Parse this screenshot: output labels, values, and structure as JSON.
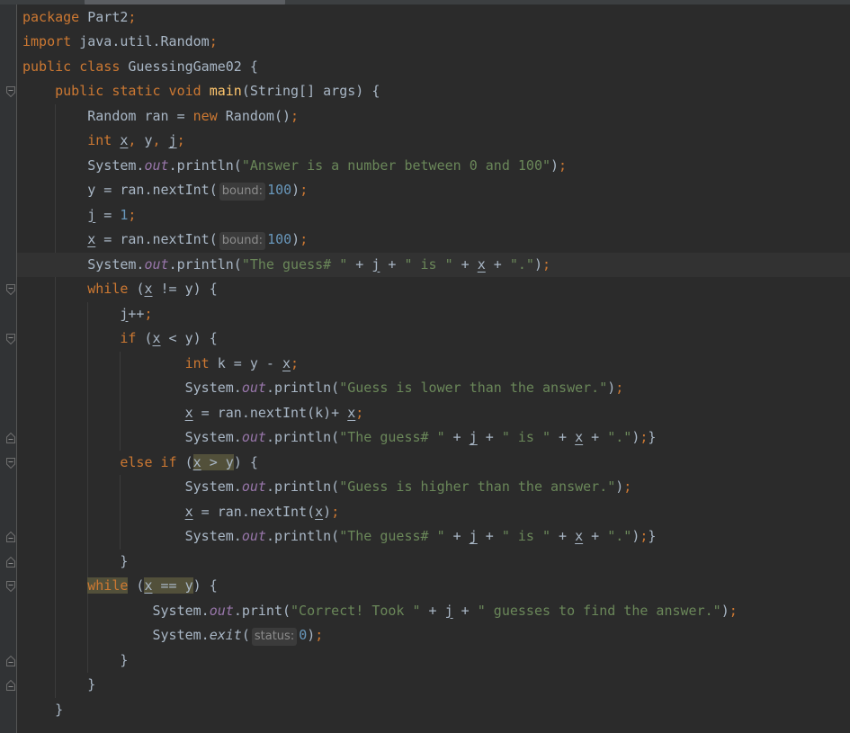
{
  "editor": {
    "language": "java",
    "current_line": 11,
    "lines": [
      {
        "n": 1,
        "tokens": [
          [
            "kw",
            "package "
          ],
          [
            "p",
            "Part2"
          ],
          [
            "semi",
            ";"
          ]
        ]
      },
      {
        "n": 2,
        "tokens": [
          [
            "kw",
            "import "
          ],
          [
            "p",
            "java.util.Random"
          ],
          [
            "semi",
            ";"
          ]
        ]
      },
      {
        "n": 3,
        "tokens": [
          [
            "kw",
            "public class "
          ],
          [
            "p",
            "GuessingGame02 {"
          ]
        ]
      },
      {
        "n": 4,
        "tokens": [
          [
            "kw",
            "    public static void "
          ],
          [
            "mth",
            "main"
          ],
          [
            "p",
            "(String[] args) {"
          ]
        ]
      },
      {
        "n": 5,
        "tokens": [
          [
            "p",
            "        Random ran = "
          ],
          [
            "kw",
            "new "
          ],
          [
            "p",
            "Random()"
          ],
          [
            "semi",
            ";"
          ]
        ]
      },
      {
        "n": 6,
        "tokens": [
          [
            "kw",
            "        int "
          ],
          [
            "var",
            "x"
          ],
          [
            "semi",
            ", "
          ],
          [
            "p",
            "y"
          ],
          [
            "semi",
            ", "
          ],
          [
            "var",
            "j"
          ],
          [
            "semi",
            ";"
          ]
        ]
      },
      {
        "n": 7,
        "tokens": [
          [
            "p",
            "        System."
          ],
          [
            "fld",
            "out"
          ],
          [
            "p",
            ".println("
          ],
          [
            "str",
            "\"Answer is a number between 0 and 100\""
          ],
          [
            "p",
            ")"
          ],
          [
            "semi",
            ";"
          ]
        ]
      },
      {
        "n": 8,
        "tokens": [
          [
            "p",
            "        y = ran.nextInt("
          ],
          [
            "hint",
            "bound:"
          ],
          [
            "num",
            "100"
          ],
          [
            "p",
            ")"
          ],
          [
            "semi",
            ";"
          ]
        ]
      },
      {
        "n": 9,
        "tokens": [
          [
            "p",
            "        "
          ],
          [
            "var",
            "j"
          ],
          [
            "p",
            " = "
          ],
          [
            "num",
            "1"
          ],
          [
            "semi",
            ";"
          ]
        ]
      },
      {
        "n": 10,
        "tokens": [
          [
            "p",
            "        "
          ],
          [
            "var",
            "x"
          ],
          [
            "p",
            " = ran.nextInt("
          ],
          [
            "hint",
            "bound:"
          ],
          [
            "num",
            "100"
          ],
          [
            "p",
            ")"
          ],
          [
            "semi",
            ";"
          ]
        ]
      },
      {
        "n": 11,
        "tokens": [
          [
            "p",
            "        System."
          ],
          [
            "fld",
            "out"
          ],
          [
            "p",
            ".println("
          ],
          [
            "str",
            "\"The guess# \""
          ],
          [
            "p",
            " + "
          ],
          [
            "var",
            "j"
          ],
          [
            "p",
            " + "
          ],
          [
            "str",
            "\" is \""
          ],
          [
            "p",
            " + "
          ],
          [
            "var",
            "x"
          ],
          [
            "p",
            " + "
          ],
          [
            "str",
            "\".\""
          ],
          [
            "p",
            ")"
          ],
          [
            "semi",
            ";"
          ]
        ]
      },
      {
        "n": 12,
        "tokens": [
          [
            "kw",
            "        while "
          ],
          [
            "p",
            "("
          ],
          [
            "var",
            "x"
          ],
          [
            "p",
            " != y) {"
          ]
        ]
      },
      {
        "n": 13,
        "tokens": [
          [
            "p",
            "            "
          ],
          [
            "var",
            "j"
          ],
          [
            "p",
            "++"
          ],
          [
            "semi",
            ";"
          ]
        ]
      },
      {
        "n": 14,
        "tokens": [
          [
            "kw",
            "            if "
          ],
          [
            "p",
            "("
          ],
          [
            "var",
            "x"
          ],
          [
            "p",
            " < y) {"
          ]
        ]
      },
      {
        "n": 15,
        "tokens": [
          [
            "kw",
            "                    int "
          ],
          [
            "p",
            "k = y - "
          ],
          [
            "var",
            "x"
          ],
          [
            "semi",
            ";"
          ]
        ]
      },
      {
        "n": 16,
        "tokens": [
          [
            "p",
            "                    System."
          ],
          [
            "fld",
            "out"
          ],
          [
            "p",
            ".println("
          ],
          [
            "str",
            "\"Guess is lower than the answer.\""
          ],
          [
            "p",
            ")"
          ],
          [
            "semi",
            ";"
          ]
        ]
      },
      {
        "n": 17,
        "tokens": [
          [
            "p",
            "                    "
          ],
          [
            "var",
            "x"
          ],
          [
            "p",
            " = ran.nextInt(k)+ "
          ],
          [
            "var",
            "x"
          ],
          [
            "semi",
            ";"
          ]
        ]
      },
      {
        "n": 18,
        "tokens": [
          [
            "p",
            "                    System."
          ],
          [
            "fld",
            "out"
          ],
          [
            "p",
            ".println("
          ],
          [
            "str",
            "\"The guess# \""
          ],
          [
            "p",
            " + "
          ],
          [
            "var",
            "j"
          ],
          [
            "p",
            " + "
          ],
          [
            "str",
            "\" is \""
          ],
          [
            "p",
            " + "
          ],
          [
            "var",
            "x"
          ],
          [
            "p",
            " + "
          ],
          [
            "str",
            "\".\""
          ],
          [
            "p",
            ")"
          ],
          [
            "semi",
            ";"
          ],
          [
            "p",
            "}"
          ]
        ]
      },
      {
        "n": 19,
        "tokens": [
          [
            "kw",
            "            else if "
          ],
          [
            "p",
            "("
          ],
          [
            "hlvar",
            "x"
          ],
          [
            "hl",
            " > y"
          ],
          [
            "p",
            ") {"
          ]
        ]
      },
      {
        "n": 20,
        "tokens": [
          [
            "p",
            "                    System."
          ],
          [
            "fld",
            "out"
          ],
          [
            "p",
            ".println("
          ],
          [
            "str",
            "\"Guess is higher than the answer.\""
          ],
          [
            "p",
            ")"
          ],
          [
            "semi",
            ";"
          ]
        ]
      },
      {
        "n": 21,
        "tokens": [
          [
            "p",
            "                    "
          ],
          [
            "var",
            "x"
          ],
          [
            "p",
            " = ran.nextInt("
          ],
          [
            "var",
            "x"
          ],
          [
            "p",
            ")"
          ],
          [
            "semi",
            ";"
          ]
        ]
      },
      {
        "n": 22,
        "tokens": [
          [
            "p",
            "                    System."
          ],
          [
            "fld",
            "out"
          ],
          [
            "p",
            ".println("
          ],
          [
            "str",
            "\"The guess# \""
          ],
          [
            "p",
            " + "
          ],
          [
            "var",
            "j"
          ],
          [
            "p",
            " + "
          ],
          [
            "str",
            "\" is \""
          ],
          [
            "p",
            " + "
          ],
          [
            "var",
            "x"
          ],
          [
            "p",
            " + "
          ],
          [
            "str",
            "\".\""
          ],
          [
            "p",
            ")"
          ],
          [
            "semi",
            ";"
          ],
          [
            "p",
            "}"
          ]
        ]
      },
      {
        "n": 23,
        "tokens": [
          [
            "p",
            "            }"
          ]
        ]
      },
      {
        "n": 24,
        "tokens": [
          [
            "p",
            "        "
          ],
          [
            "hlkw",
            "while"
          ],
          [
            "p",
            " ("
          ],
          [
            "hlvar",
            "x"
          ],
          [
            "hl",
            " == y"
          ],
          [
            "p",
            ") {"
          ]
        ]
      },
      {
        "n": 25,
        "tokens": [
          [
            "p",
            "                System."
          ],
          [
            "fld",
            "out"
          ],
          [
            "p",
            ".print("
          ],
          [
            "str",
            "\"Correct! Took \""
          ],
          [
            "p",
            " + "
          ],
          [
            "var",
            "j"
          ],
          [
            "p",
            " + "
          ],
          [
            "str",
            "\" guesses to find the answer.\""
          ],
          [
            "p",
            ")"
          ],
          [
            "semi",
            ";"
          ]
        ]
      },
      {
        "n": 26,
        "tokens": [
          [
            "p",
            "                System."
          ],
          [
            "st",
            "exit"
          ],
          [
            "p",
            "("
          ],
          [
            "hint",
            "status:"
          ],
          [
            "num",
            "0"
          ],
          [
            "p",
            ")"
          ],
          [
            "semi",
            ";"
          ]
        ]
      },
      {
        "n": 27,
        "tokens": [
          [
            "p",
            "            }"
          ]
        ]
      },
      {
        "n": 28,
        "tokens": [
          [
            "p",
            "        }"
          ]
        ]
      },
      {
        "n": 29,
        "tokens": [
          [
            "p",
            "    }"
          ]
        ]
      }
    ],
    "fold_markers": [
      {
        "line": 4,
        "type": "fold-start"
      },
      {
        "line": 12,
        "type": "fold-start"
      },
      {
        "line": 14,
        "type": "fold-start"
      },
      {
        "line": 18,
        "type": "fold-end"
      },
      {
        "line": 19,
        "type": "fold-start"
      },
      {
        "line": 22,
        "type": "fold-end"
      },
      {
        "line": 23,
        "type": "fold-end"
      },
      {
        "line": 24,
        "type": "fold-start"
      },
      {
        "line": 27,
        "type": "fold-end"
      },
      {
        "line": 28,
        "type": "fold-end"
      }
    ]
  },
  "colors": {
    "background": "#2b2b2b",
    "keyword": "#cc7832",
    "string": "#6a8759",
    "number": "#6897bb",
    "field": "#9876aa",
    "method": "#ffc66d",
    "text": "#a9b7c6",
    "highlight": "#52503a"
  }
}
